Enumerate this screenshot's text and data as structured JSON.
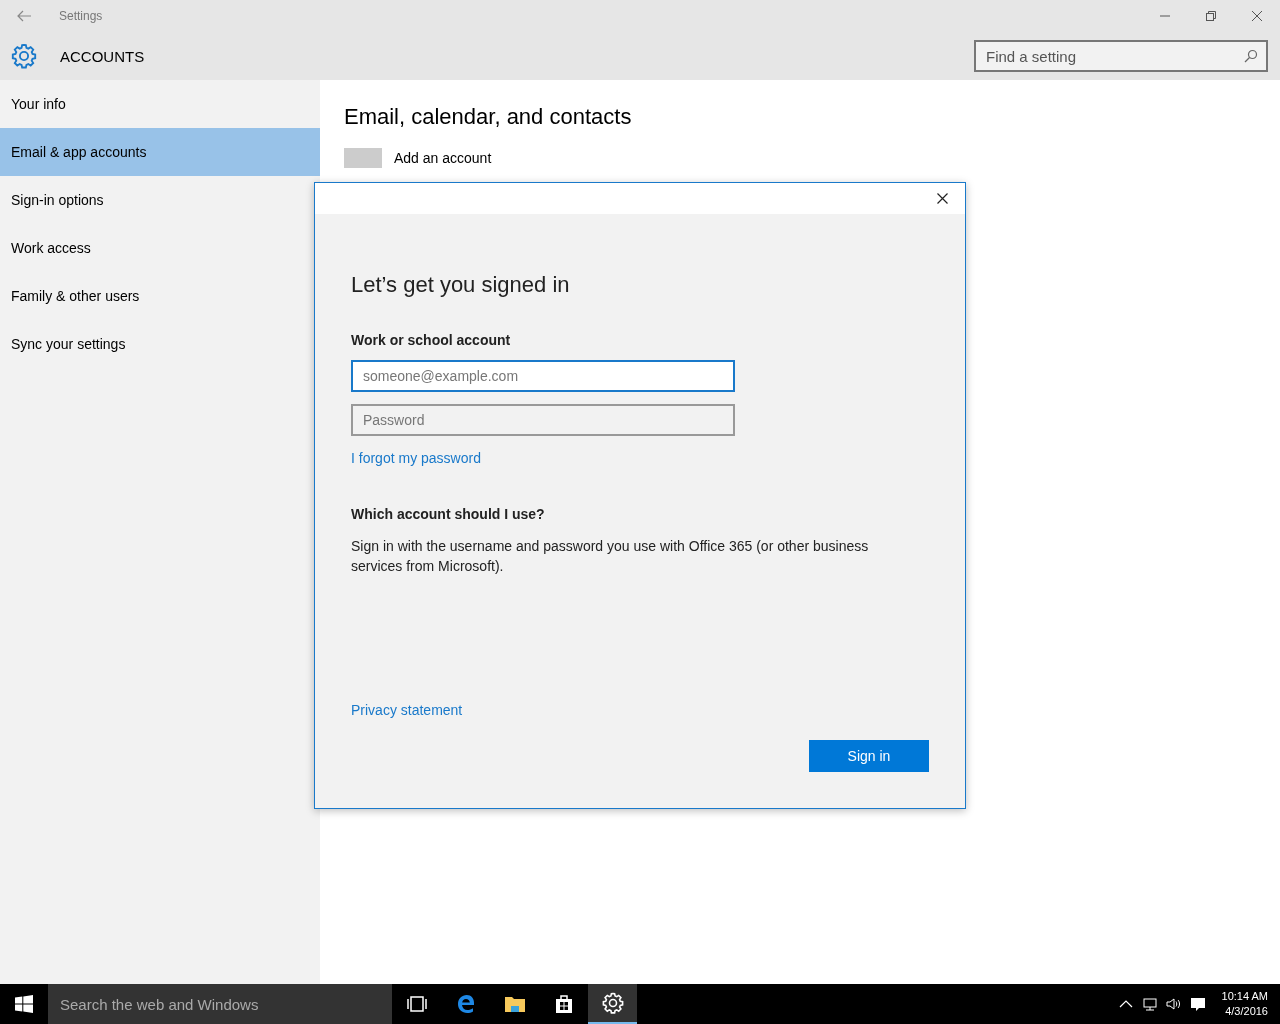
{
  "window": {
    "title": "Settings"
  },
  "header": {
    "title": "ACCOUNTS",
    "search": {
      "placeholder": "Find a setting"
    }
  },
  "sidebar": {
    "items": [
      {
        "label": "Your info",
        "selected": false
      },
      {
        "label": "Email & app accounts",
        "selected": true
      },
      {
        "label": "Sign-in options",
        "selected": false
      },
      {
        "label": "Work access",
        "selected": false
      },
      {
        "label": "Family & other users",
        "selected": false
      },
      {
        "label": "Sync your settings",
        "selected": false
      }
    ]
  },
  "content": {
    "heading": "Email, calendar, and contacts",
    "add_account": "Add an account"
  },
  "dialog": {
    "title": "Let’s get you signed in",
    "account_label": "Work or school account",
    "email": {
      "placeholder": "someone@example.com"
    },
    "password": {
      "placeholder": "Password"
    },
    "forgot_link": "I forgot my password",
    "help_heading": "Which account should I use?",
    "help_text": "Sign in with the username and password you use with Office 365 (or other business services from Microsoft).",
    "privacy_link": "Privacy statement",
    "sign_in_button": "Sign in"
  },
  "taskbar": {
    "search_placeholder": "Search the web and Windows",
    "apps": [
      {
        "kind": "task-view",
        "selected": false
      },
      {
        "kind": "browser",
        "selected": false
      },
      {
        "kind": "folder",
        "selected": false
      },
      {
        "kind": "store",
        "selected": false
      },
      {
        "kind": "settings",
        "selected": true
      }
    ],
    "clock": {
      "time": "10:14 AM",
      "date": "4/3/2016"
    }
  }
}
